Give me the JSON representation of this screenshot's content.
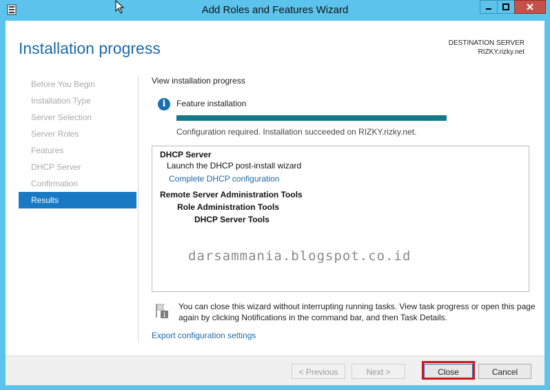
{
  "window": {
    "title": "Add Roles and Features Wizard"
  },
  "page": {
    "title": "Installation progress",
    "destination_label": "DESTINATION SERVER",
    "destination_server": "RIZKY.rizky.net"
  },
  "nav": {
    "items": [
      {
        "label": "Before You Begin",
        "active": false
      },
      {
        "label": "Installation Type",
        "active": false
      },
      {
        "label": "Server Selection",
        "active": false
      },
      {
        "label": "Server Roles",
        "active": false
      },
      {
        "label": "Features",
        "active": false
      },
      {
        "label": "DHCP Server",
        "active": false
      },
      {
        "label": "Confirmation",
        "active": false
      },
      {
        "label": "Results",
        "active": true
      }
    ]
  },
  "content": {
    "subheading": "View installation progress",
    "feature_label": "Feature installation",
    "progress_fraction": 1.0,
    "status_text": "Configuration required. Installation succeeded on RIZKY.rizky.net.",
    "results": {
      "dhcp_server": "DHCP Server",
      "launch_wizard": "Launch the DHCP post-install wizard",
      "complete_link": "Complete DHCP configuration",
      "rsat": "Remote Server Administration Tools",
      "role_admin": "Role Administration Tools",
      "dhcp_tools": "DHCP Server Tools"
    },
    "watermark": "darsammania.blogspot.co.id",
    "note_text": "You can close this wizard without interrupting running tasks. View task progress or open this page again by clicking Notifications in the command bar, and then Task Details.",
    "note_badge": "1",
    "export_link": "Export configuration settings"
  },
  "footer": {
    "previous": "< Previous",
    "next": "Next >",
    "close": "Close",
    "cancel": "Cancel"
  },
  "colors": {
    "accent": "#1979c3",
    "progress": "#11798b",
    "highlight": "#d0141a"
  }
}
